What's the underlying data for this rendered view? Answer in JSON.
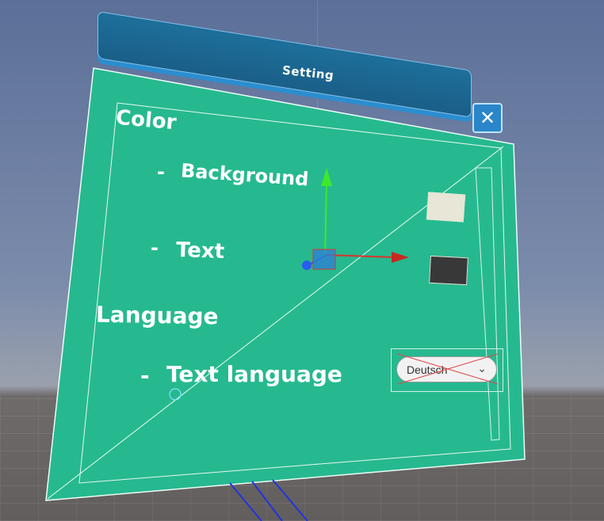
{
  "window": {
    "title": "Setting",
    "close_glyph": "✕"
  },
  "sections": {
    "color_heading": "Color",
    "background_label": "Background",
    "text_label": "Text",
    "language_heading": "Language",
    "text_language_label": "Text language",
    "bullet": "-"
  },
  "swatches": {
    "background_color": "#e8e6d6",
    "text_color": "#383838"
  },
  "language_dropdown": {
    "selected": "Deutsch"
  },
  "colors": {
    "panel": "#26b98f",
    "titlebar": "#1b6690",
    "accent_border": "#2a86c8"
  }
}
